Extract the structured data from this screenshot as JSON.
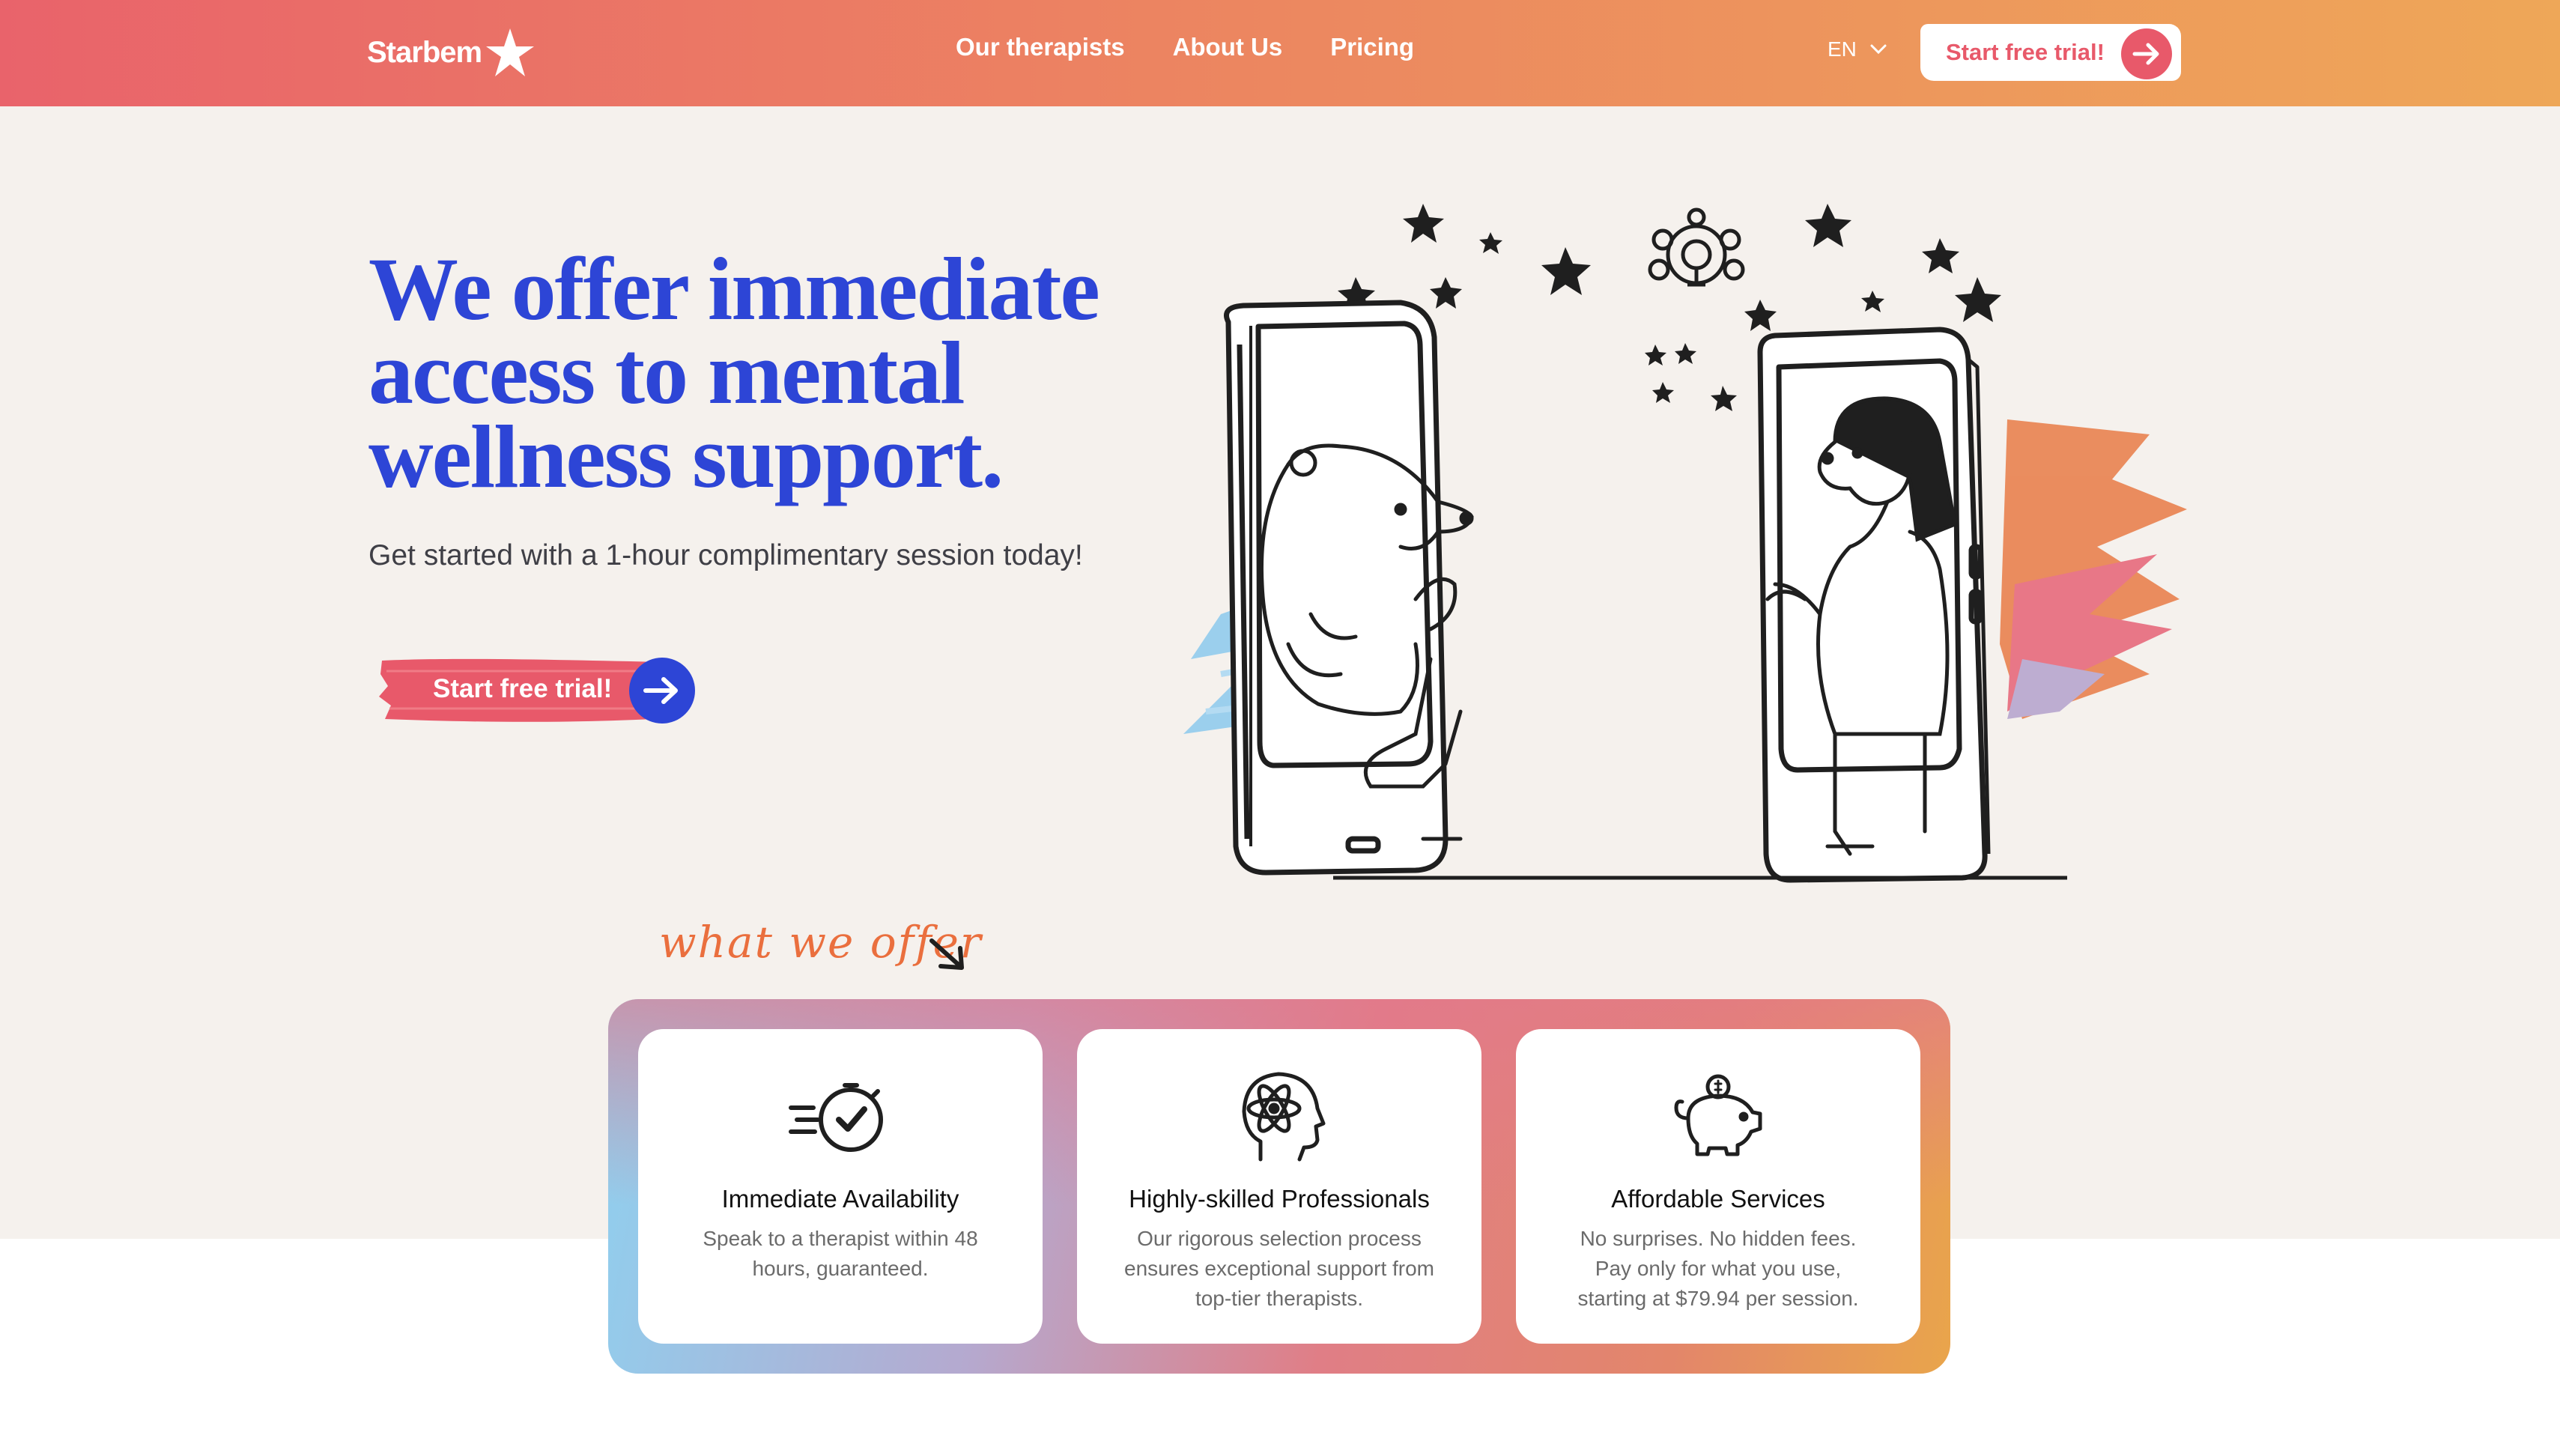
{
  "header": {
    "brand": "Starbem",
    "nav": [
      {
        "label": "Our therapists"
      },
      {
        "label": "About Us"
      },
      {
        "label": "Pricing"
      }
    ],
    "language": "EN",
    "cta_label": "Start free trial!"
  },
  "hero": {
    "title": "We offer immediate access to mental wellness support.",
    "subtitle": "Get started with a 1-hour complimentary session today!",
    "cta_label": "Start free trial!"
  },
  "offer": {
    "label": "what we offer",
    "cards": [
      {
        "icon": "stopwatch-check-icon",
        "title": "Immediate Availability",
        "description": "Speak to a therapist within  48 hours, guaranteed."
      },
      {
        "icon": "head-atom-icon",
        "title": "Highly-skilled Professionals",
        "description": "Our rigorous selection process ensures exceptional support from top-tier therapists."
      },
      {
        "icon": "piggy-bank-icon",
        "title": "Affordable Services",
        "description": "No surprises. No hidden fees. Pay only for what you use, starting at $79.94 per session."
      }
    ]
  },
  "colors": {
    "brand_coral": "#e8596a",
    "brand_blue": "#2d45d6",
    "hero_bg": "#f5f1ed",
    "offer_label": "#ea6f3e"
  }
}
